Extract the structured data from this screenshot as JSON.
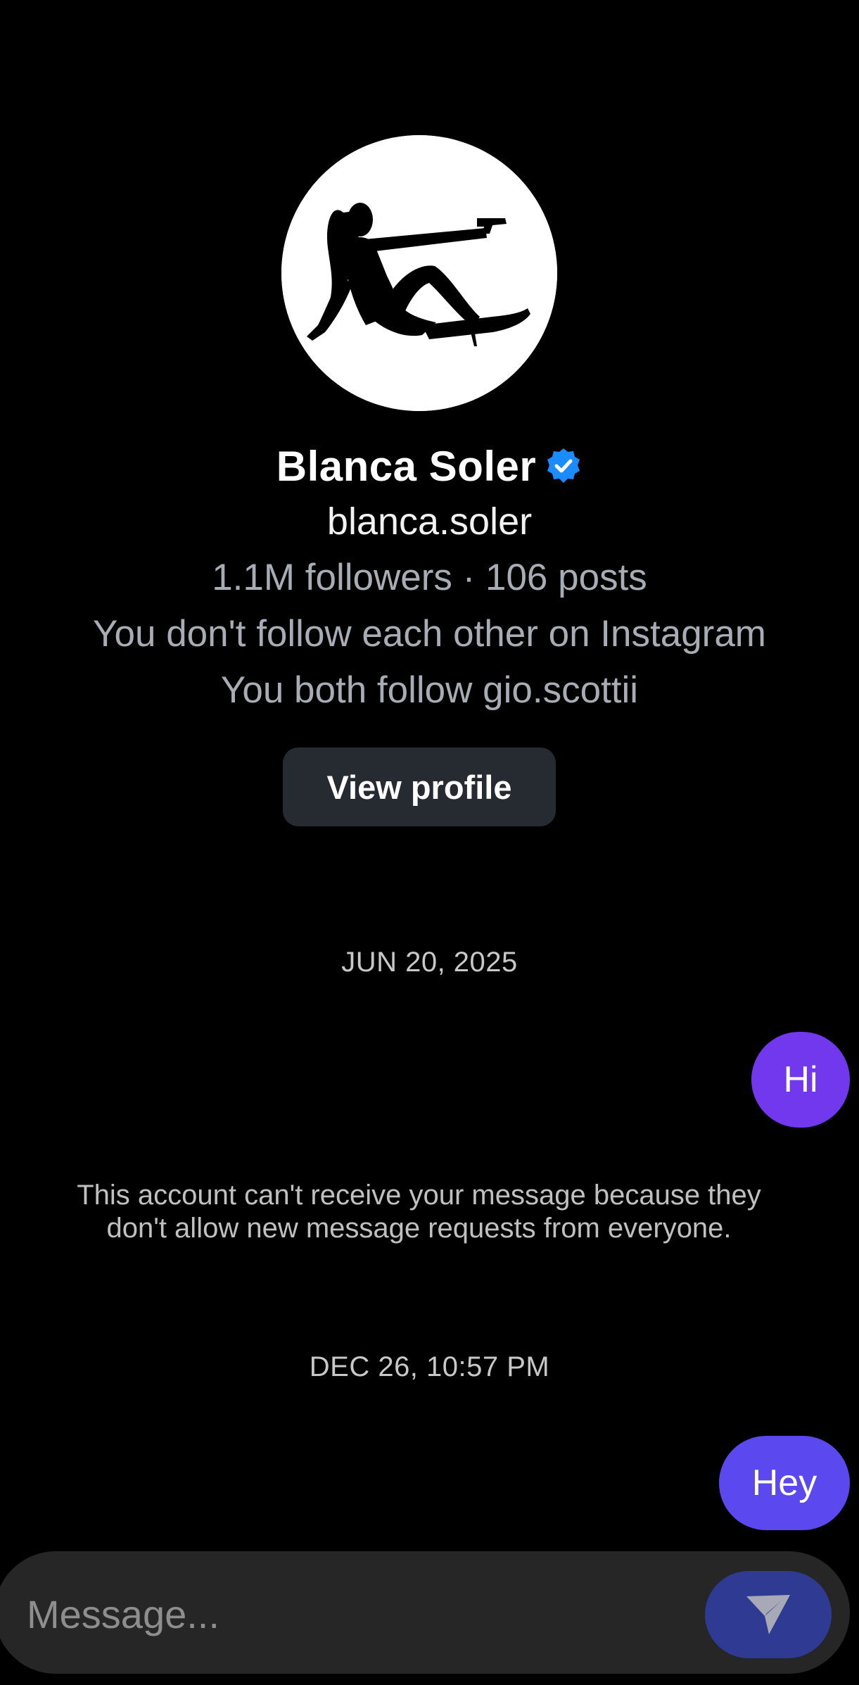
{
  "profile": {
    "display_name": "Blanca Soler",
    "username": "blanca.soler",
    "stats": "1.1M followers · 106 posts",
    "follow_status": "You don't follow each other on Instagram",
    "mutual": "You both follow gio.scottii",
    "view_profile_label": "View profile",
    "avatar_icon": "silhouette-avatar",
    "verified_icon": "verified-badge-icon"
  },
  "thread": {
    "date_1": "JUN 20, 2025",
    "message_1": "Hi",
    "notice": "This account can't receive your message because they don't allow new message requests from everyone.",
    "date_2": "DEC 26, 10:57 PM",
    "message_2": "Hey"
  },
  "composer": {
    "placeholder": "Message...",
    "send_icon": "send-icon"
  },
  "colors": {
    "background": "#000000",
    "bubble_hi": "#7138ed",
    "bubble_hey": "#5b48ef",
    "verified": "#1a8cff",
    "button": "#262a31",
    "send_button": "#2f3a93"
  }
}
